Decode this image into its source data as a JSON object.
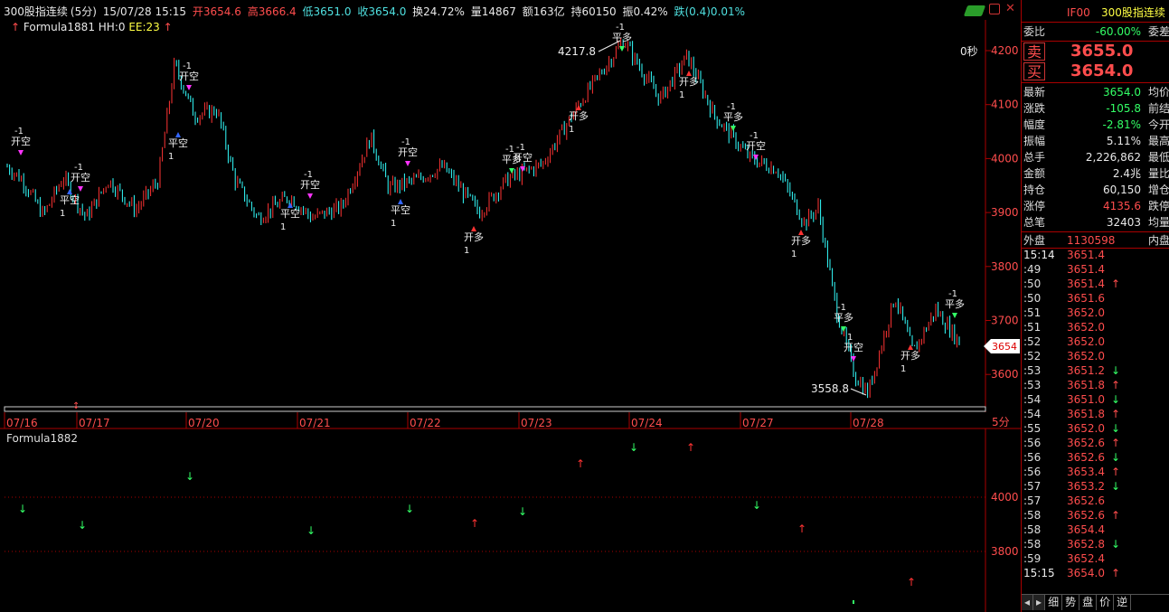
{
  "header": {
    "name": "300股指连续",
    "period": "(5分)",
    "datetime": "15/07/28 15:15",
    "open": "开3654.6",
    "high": "高3666.4",
    "low": "低3651.0",
    "close": "收3654.0",
    "turnover": "换24.72%",
    "volume": "量14867",
    "amount": "额163亿",
    "oi": "持60150",
    "amplitude": "振0.42%",
    "change": "跌(0.4)0.01%"
  },
  "indicator_line": "Formula1881 HH:0",
  "indicator_ee": "EE:23",
  "countdown": "0秒",
  "main_axis": {
    "labels": [
      "4200",
      "4100",
      "4000",
      "3900",
      "3800",
      "3700",
      "3600"
    ],
    "values": [
      4200,
      4100,
      4000,
      3900,
      3800,
      3700,
      3600
    ]
  },
  "current_price_tag": "3654",
  "high_mark": "4217.8",
  "low_mark": "3558.8",
  "dates": [
    "07/16",
    "07/17",
    "07/20",
    "07/21",
    "07/22",
    "07/23",
    "07/24",
    "07/27",
    "07/28"
  ],
  "period_label": "5分",
  "sub_title": "Formula1882",
  "sub_axis": {
    "labels": [
      "4000",
      "3800"
    ],
    "values": [
      4000,
      3800
    ]
  },
  "signals": [
    {
      "label": "开空",
      "qty": "-1"
    },
    {
      "label": "平空",
      "qty": "1"
    },
    {
      "label": "开多",
      "qty": "-1"
    },
    {
      "label": "平多",
      "qty": "1"
    }
  ],
  "colors": {
    "up": "#ff3333",
    "down": "#33ffff",
    "bg": "#000000",
    "sell": "#ff4d4d",
    "buy_green": "#33ff66",
    "panel_border": "#aa0000"
  },
  "right_panel": {
    "symbol": "IF00",
    "name": "300股指连续",
    "weibi_label": "委比",
    "weibi_value": "-60.00%",
    "weicha_label": "委差",
    "sell_label": "卖",
    "sell_price": "3655.0",
    "buy_label": "买",
    "buy_price": "3654.0",
    "stats": [
      {
        "label": "最新",
        "value": "3654.0",
        "color": "#33ff66",
        "right": "均价"
      },
      {
        "label": "涨跌",
        "value": "-105.8",
        "color": "#33ff66",
        "right": "前结"
      },
      {
        "label": "幅度",
        "value": "-2.81%",
        "color": "#33ff66",
        "right": "今开"
      },
      {
        "label": "振幅",
        "value": "5.11%",
        "color": "#e8e8e8",
        "right": "最高"
      },
      {
        "label": "总手",
        "value": "2,226,862",
        "color": "#e8e8e8",
        "right": "最低"
      },
      {
        "label": "金额",
        "value": "2.4兆",
        "color": "#e8e8e8",
        "right": "量比"
      },
      {
        "label": "持仓",
        "value": "60,150",
        "color": "#e8e8e8",
        "right": "增仓"
      },
      {
        "label": "涨停",
        "value": "4135.6",
        "color": "#ff4d4d",
        "right": "跌停"
      },
      {
        "label": "总笔",
        "value": "32403",
        "color": "#e8e8e8",
        "right": "均量"
      }
    ],
    "outer_label": "外盘",
    "outer_value": "1130598",
    "inner_label": "内盘",
    "ticks": [
      {
        "t": "15:14",
        "p": "3651.4",
        "a": ""
      },
      {
        "t": ":49",
        "p": "3651.4",
        "a": ""
      },
      {
        "t": ":50",
        "p": "3651.4",
        "a": "↑"
      },
      {
        "t": ":50",
        "p": "3651.6",
        "a": ""
      },
      {
        "t": ":51",
        "p": "3652.0",
        "a": ""
      },
      {
        "t": ":51",
        "p": "3652.0",
        "a": ""
      },
      {
        "t": ":52",
        "p": "3652.0",
        "a": ""
      },
      {
        "t": ":52",
        "p": "3652.0",
        "a": ""
      },
      {
        "t": ":53",
        "p": "3651.2",
        "a": "↓"
      },
      {
        "t": ":53",
        "p": "3651.8",
        "a": "↑"
      },
      {
        "t": ":54",
        "p": "3651.0",
        "a": "↓"
      },
      {
        "t": ":54",
        "p": "3651.8",
        "a": "↑"
      },
      {
        "t": ":55",
        "p": "3652.0",
        "a": "↓"
      },
      {
        "t": ":56",
        "p": "3652.6",
        "a": "↑"
      },
      {
        "t": ":56",
        "p": "3652.6",
        "a": "↓"
      },
      {
        "t": ":56",
        "p": "3653.4",
        "a": "↑"
      },
      {
        "t": ":57",
        "p": "3653.2",
        "a": "↓"
      },
      {
        "t": ":57",
        "p": "3652.6",
        "a": ""
      },
      {
        "t": ":58",
        "p": "3652.6",
        "a": "↑"
      },
      {
        "t": ":58",
        "p": "3654.4",
        "a": ""
      },
      {
        "t": ":58",
        "p": "3652.8",
        "a": "↓"
      },
      {
        "t": ":59",
        "p": "3652.4",
        "a": ""
      },
      {
        "t": "15:15",
        "p": "3654.0",
        "a": "↑"
      }
    ],
    "tabs": [
      "细",
      "势",
      "盘",
      "价",
      "逆"
    ]
  }
}
